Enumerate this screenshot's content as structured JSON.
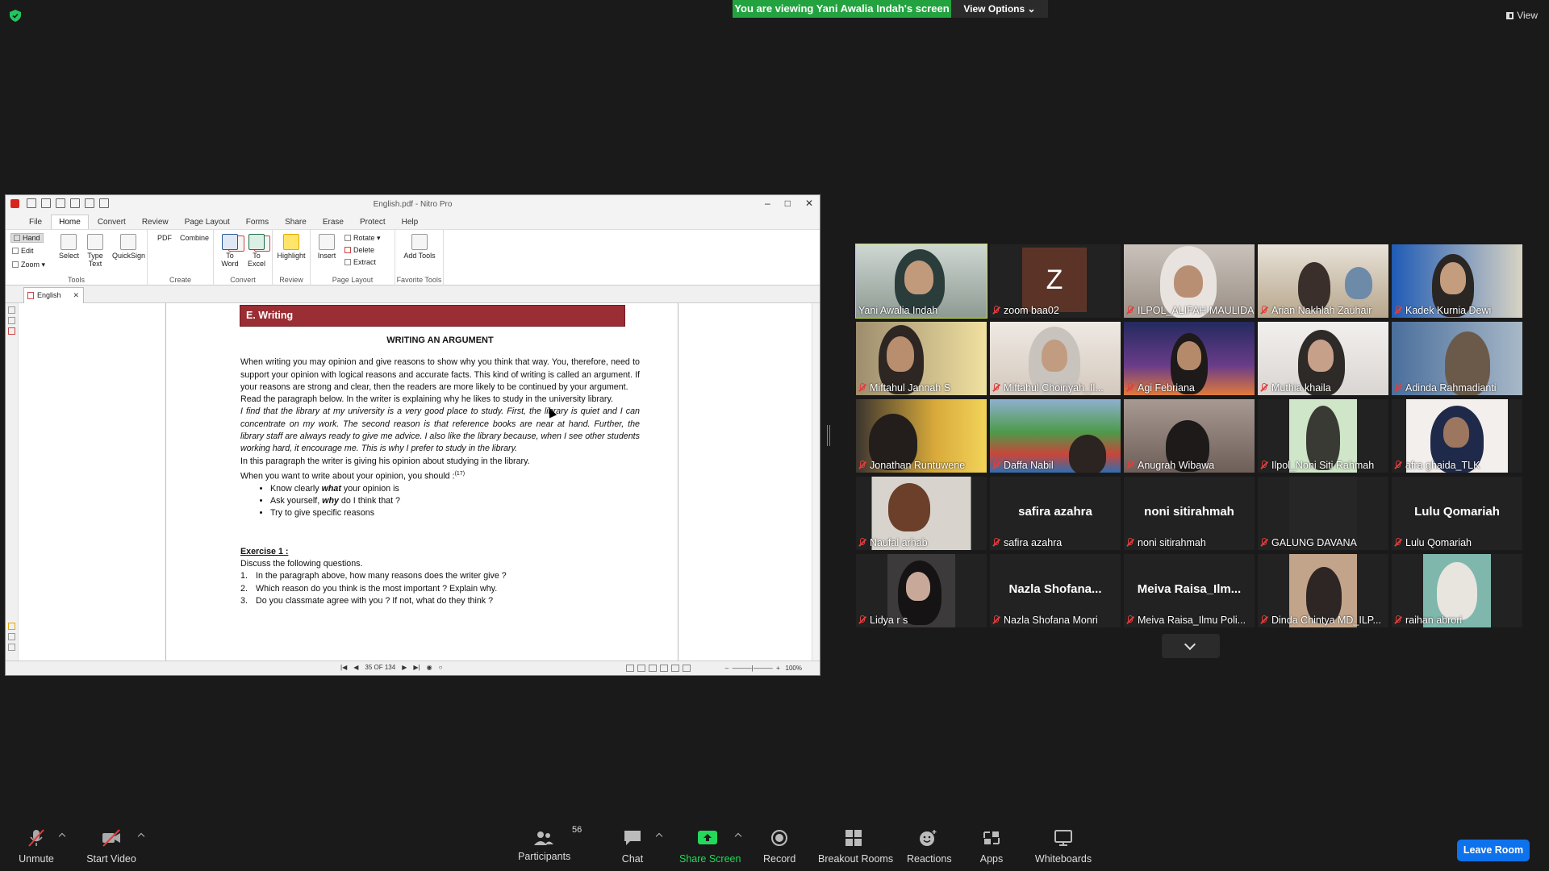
{
  "meeting": {
    "sharing_banner": "You are viewing Yani Awalia Indah's screen",
    "view_options_label": "View Options",
    "view_label": "View"
  },
  "nitro": {
    "window_title": "English.pdf - Nitro Pro",
    "menu_tabs": [
      "File",
      "Home",
      "Convert",
      "Review",
      "Page Layout",
      "Forms",
      "Share",
      "Erase",
      "Protect",
      "Help"
    ],
    "ribbon": {
      "hand": "Hand",
      "edit": "Edit",
      "zoom": "Zoom",
      "select": "Select",
      "type_text": "Type Text",
      "quicksign": "QuickSign",
      "tools_group": "Tools",
      "pdf": "PDF",
      "combine": "Combine",
      "create_group": "Create",
      "to_word": "To Word",
      "to_excel": "To Excel",
      "convert_group": "Convert",
      "highlight": "Highlight",
      "review_group": "Review",
      "insert": "Insert",
      "rotate": "Rotate",
      "delete": "Delete",
      "extract": "Extract",
      "page_layout_group": "Page Layout",
      "add_tools": "Add Tools",
      "favorite_group": "Favorite Tools"
    },
    "doc_tab": "English",
    "page_indicator": "35 OF 134",
    "zoom_level": "100%"
  },
  "document": {
    "section_title": "E. Writing",
    "heading": "WRITING AN ARGUMENT",
    "para1": "When writing you may opinion and give reasons to show why you think that way. You, therefore, need to support your opinion with logical reasons and accurate facts. This kind of writing is called an argument. If your reasons are strong and clear, then the readers are more likely to be continued by your argument.",
    "para2": "Read the paragraph below. In the writer is explaining why he likes to study in the university library.",
    "para_italic": "I find that the library at my university is a very good place to study. First, the library is quiet and I can concentrate on my work. The second reason is that reference books are near at hand. Further, the library staff are always ready to give me advice. I also like the library because, when I see other students working hard, it encourage me. This is why I prefer to study in the library.",
    "para3": "In this paragraph the writer is giving his opinion about studying in the library.",
    "para4": "When you want to write about your opinion, you should :",
    "para4_sup": "(17)",
    "bullet1_pre": "Know clearly ",
    "bullet1_em": "what",
    "bullet1_post": " your opinion is",
    "bullet2_pre": "Ask yourself, ",
    "bullet2_em": "why",
    "bullet2_post": " do I think that ?",
    "bullet3": "Try to give specific reasons",
    "exercise_title": "Exercise 1",
    "exercise_colon": " :",
    "exercise_intro": "Discuss the following questions.",
    "questions": [
      {
        "num": "1.",
        "text": "In the paragraph above, how many reasons does the writer give ?"
      },
      {
        "num": "2.",
        "text": "Which reason do you think is the most important ? Explain why."
      },
      {
        "num": "3.",
        "text": "Do you classmate agree with you ? If not, what do they think ?"
      }
    ]
  },
  "participants_gallery": [
    {
      "name": "Yani Awalia Indah",
      "muted": false,
      "video": true
    },
    {
      "name": "zoom baa02",
      "muted": true,
      "video": false,
      "avatar_letter": "Z"
    },
    {
      "name": "ILPOL_ALIFAH MAULIDA",
      "muted": true,
      "video": true
    },
    {
      "name": "Arian Nakhlah Zauhair",
      "muted": true,
      "video": true
    },
    {
      "name": "Kadek Kurnia Dewi",
      "muted": true,
      "video": true
    },
    {
      "name": "Miftahul Jannah S",
      "muted": true,
      "video": true
    },
    {
      "name": "Miftahul Choiriyah_Il...",
      "muted": true,
      "video": true
    },
    {
      "name": "Agi Febriana",
      "muted": true,
      "video": true
    },
    {
      "name": "Muthia khaila",
      "muted": true,
      "video": true
    },
    {
      "name": "Adinda Rahmadianti",
      "muted": true,
      "video": true
    },
    {
      "name": "Jonathan Runtuwene",
      "muted": true,
      "video": true
    },
    {
      "name": "Daffa Nabil",
      "muted": true,
      "video": true
    },
    {
      "name": "Anugrah Wibawa",
      "muted": true,
      "video": true
    },
    {
      "name": "Ilpol_Noni Siti Rahmah",
      "muted": true,
      "video": true
    },
    {
      "name": "afra ghaida_TLK",
      "muted": true,
      "video": true
    },
    {
      "name": "Naufal arhab",
      "muted": true,
      "video": true
    },
    {
      "name": "safira azahra",
      "muted": true,
      "video": false,
      "center_name": "safira azahra"
    },
    {
      "name": "noni sitirahmah",
      "muted": true,
      "video": false,
      "center_name": "noni sitirahmah"
    },
    {
      "name": "GALUNG DAVANA",
      "muted": true,
      "video": false,
      "center_name": ""
    },
    {
      "name": "Lulu Qomariah",
      "muted": true,
      "video": false,
      "center_name": "Lulu Qomariah"
    },
    {
      "name": "Lidya r s",
      "muted": true,
      "video": true
    },
    {
      "name": "Nazla Shofana Monri",
      "muted": true,
      "video": false,
      "center_name": "Nazla Shofana..."
    },
    {
      "name": "Meiva Raisa_Ilmu Poli...",
      "muted": true,
      "video": false,
      "center_name": "Meiva Raisa_Ilm..."
    },
    {
      "name": "Dinda Chintya MD_ILP...",
      "muted": true,
      "video": true
    },
    {
      "name": "raihan abrori",
      "muted": true,
      "video": true
    }
  ],
  "toolbar": {
    "unmute": "Unmute",
    "start_video": "Start Video",
    "participants": "Participants",
    "participants_count": "56",
    "chat": "Chat",
    "share_screen": "Share Screen",
    "record": "Record",
    "breakout_rooms": "Breakout Rooms",
    "reactions": "Reactions",
    "apps": "Apps",
    "whiteboards": "Whiteboards",
    "leave_room": "Leave Room"
  },
  "colors": {
    "share_green": "#22a33f",
    "speaker_highlight": "#c7e34a",
    "leave_blue": "#0e72ed",
    "muted_red": "#e03e3e",
    "section_bar": "#9b2d34"
  }
}
